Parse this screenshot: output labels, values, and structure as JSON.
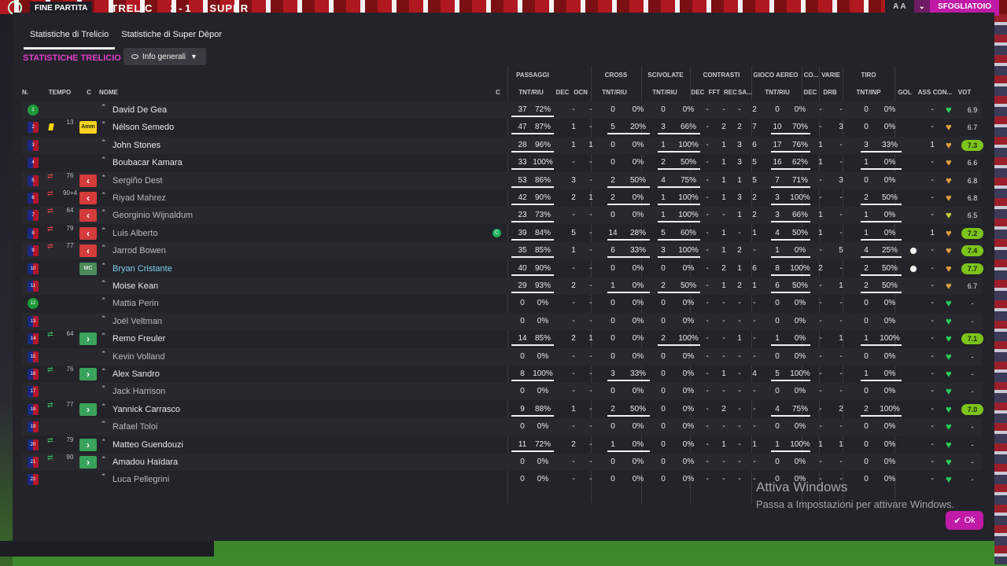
{
  "topbar": {
    "fine_partita": "FINE PARTITA",
    "home": "TRELIC",
    "score": "2 - 1",
    "away": "SUPER",
    "zoom": "A A",
    "sfogliatoio": "SFOGLIATOIO"
  },
  "tabs": [
    {
      "label": "Statistiche di Trelicio",
      "active": true
    },
    {
      "label": "Statistiche di Super Dèpor",
      "active": false
    }
  ],
  "section_title": "STATISTICHE TRELICIO",
  "view_dropdown": {
    "selected": "Info generali"
  },
  "column_groups": [
    "PASSAGGI",
    "CROSS",
    "SCIVOLATE",
    "CONTRASTI",
    "GIOCO AEREO",
    "CO...",
    "VARIE",
    "TIRO"
  ],
  "columns": {
    "n": "N.",
    "tempo": "TEMPO",
    "c": "C",
    "nome": "NOME",
    "c2": "C",
    "pass_tnt": "TNT/RIU",
    "pass_dec": "DEC",
    "pass_ocn": "OCN",
    "cross_tnt": "TNT/RIU",
    "scivol_tnt": "TNT/RIU",
    "con_dec": "DEC",
    "con_fft": "FFT",
    "con_rec": "REC",
    "con_sa": "SA...",
    "aereo_tnt": "TNT/RIU",
    "co_dec": "DEC",
    "varie_drb": "DRB",
    "tiro_tnt": "TNT/INP",
    "gol": "GOL",
    "ass": "ASS",
    "con": "CON...",
    "vot": "VOT"
  },
  "players": [
    {
      "n": "1",
      "gk": true,
      "card": "",
      "sub_dir": "",
      "sub_min": "",
      "role": "",
      "name": "David De Gea",
      "style": "",
      "c": "",
      "pass_t": "37",
      "pass_p": "72%",
      "pass_dec": "-",
      "pass_ocn": "-",
      "cross_t": "0",
      "cross_p": "0%",
      "sci_t": "0",
      "sci_p": "0%",
      "con_dec": "-",
      "con_fft": "-",
      "con_rec": "-",
      "con_sa": "2",
      "aer_t": "0",
      "aer_p": "0%",
      "co_dec": "-",
      "drb": "-",
      "tiro_t": "0",
      "tiro_p": "0%",
      "gol": "",
      "ass": "-",
      "heart": "g",
      "vot": "6.9",
      "vot_hi": false
    },
    {
      "n": "2",
      "gk": false,
      "card": "y",
      "sub_dir": "",
      "sub_min": "13",
      "role": "Amm",
      "name": "Nélson Semedo",
      "style": "",
      "c": "",
      "pass_t": "47",
      "pass_p": "87%",
      "pass_dec": "1",
      "pass_ocn": "-",
      "cross_t": "5",
      "cross_p": "20%",
      "sci_t": "3",
      "sci_p": "66%",
      "con_dec": "-",
      "con_fft": "2",
      "con_rec": "2",
      "con_sa": "7",
      "aer_t": "10",
      "aer_p": "70%",
      "co_dec": "-",
      "drb": "3",
      "tiro_t": "0",
      "tiro_p": "0%",
      "gol": "",
      "ass": "-",
      "heart": "o",
      "vot": "6.7",
      "vot_hi": false
    },
    {
      "n": "3",
      "gk": false,
      "card": "",
      "sub_dir": "",
      "sub_min": "",
      "role": "",
      "name": "John Stones",
      "style": "",
      "c": "",
      "pass_t": "28",
      "pass_p": "96%",
      "pass_dec": "1",
      "pass_ocn": "1",
      "cross_t": "0",
      "cross_p": "0%",
      "sci_t": "1",
      "sci_p": "100%",
      "con_dec": "-",
      "con_fft": "1",
      "con_rec": "3",
      "con_sa": "6",
      "aer_t": "17",
      "aer_p": "76%",
      "co_dec": "1",
      "drb": "-",
      "tiro_t": "3",
      "tiro_p": "33%",
      "gol": "",
      "ass": "1",
      "heart": "o",
      "vot": "7.3",
      "vot_hi": true
    },
    {
      "n": "4",
      "gk": false,
      "card": "",
      "sub_dir": "",
      "sub_min": "",
      "role": "",
      "name": "Boubacar Kamara",
      "style": "",
      "c": "",
      "pass_t": "33",
      "pass_p": "100%",
      "pass_dec": "-",
      "pass_ocn": "-",
      "cross_t": "0",
      "cross_p": "0%",
      "sci_t": "2",
      "sci_p": "50%",
      "con_dec": "-",
      "con_fft": "1",
      "con_rec": "3",
      "con_sa": "5",
      "aer_t": "16",
      "aer_p": "62%",
      "co_dec": "1",
      "drb": "-",
      "tiro_t": "1",
      "tiro_p": "0%",
      "gol": "",
      "ass": "-",
      "heart": "o",
      "vot": "6.6",
      "vot_hi": false
    },
    {
      "n": "5",
      "gk": false,
      "card": "",
      "sub_dir": "out",
      "sub_min": "76",
      "role": "out",
      "name": "Sergiño Dest",
      "style": "dim",
      "c": "",
      "pass_t": "53",
      "pass_p": "86%",
      "pass_dec": "3",
      "pass_ocn": "-",
      "cross_t": "2",
      "cross_p": "50%",
      "sci_t": "4",
      "sci_p": "75%",
      "con_dec": "-",
      "con_fft": "1",
      "con_rec": "1",
      "con_sa": "5",
      "aer_t": "7",
      "aer_p": "71%",
      "co_dec": "-",
      "drb": "3",
      "tiro_t": "0",
      "tiro_p": "0%",
      "gol": "",
      "ass": "-",
      "heart": "o",
      "vot": "6.8",
      "vot_hi": false
    },
    {
      "n": "6",
      "gk": false,
      "card": "",
      "sub_dir": "out",
      "sub_min": "90+4",
      "role": "out",
      "name": "Riyad Mahrez",
      "style": "dim",
      "c": "",
      "pass_t": "42",
      "pass_p": "90%",
      "pass_dec": "2",
      "pass_ocn": "1",
      "cross_t": "2",
      "cross_p": "0%",
      "sci_t": "1",
      "sci_p": "100%",
      "con_dec": "-",
      "con_fft": "1",
      "con_rec": "3",
      "con_sa": "2",
      "aer_t": "3",
      "aer_p": "100%",
      "co_dec": "-",
      "drb": "-",
      "tiro_t": "2",
      "tiro_p": "50%",
      "gol": "",
      "ass": "-",
      "heart": "o",
      "vot": "6.8",
      "vot_hi": false
    },
    {
      "n": "7",
      "gk": false,
      "card": "",
      "sub_dir": "out",
      "sub_min": "64",
      "role": "out",
      "name": "Georginio Wijnaldum",
      "style": "dim",
      "c": "",
      "pass_t": "23",
      "pass_p": "73%",
      "pass_dec": "-",
      "pass_ocn": "-",
      "cross_t": "0",
      "cross_p": "0%",
      "sci_t": "1",
      "sci_p": "100%",
      "con_dec": "-",
      "con_fft": "-",
      "con_rec": "1",
      "con_sa": "2",
      "aer_t": "3",
      "aer_p": "66%",
      "co_dec": "1",
      "drb": "-",
      "tiro_t": "1",
      "tiro_p": "0%",
      "gol": "",
      "ass": "-",
      "heart": "y",
      "vot": "6.5",
      "vot_hi": false
    },
    {
      "n": "8",
      "gk": false,
      "card": "",
      "sub_dir": "out",
      "sub_min": "79",
      "role": "out",
      "name": "Luis Alberto",
      "style": "dim",
      "c": "c",
      "pass_t": "39",
      "pass_p": "84%",
      "pass_dec": "5",
      "pass_ocn": "-",
      "cross_t": "14",
      "cross_p": "28%",
      "sci_t": "5",
      "sci_p": "60%",
      "con_dec": "-",
      "con_fft": "1",
      "con_rec": "-",
      "con_sa": "1",
      "aer_t": "4",
      "aer_p": "50%",
      "co_dec": "1",
      "drb": "-",
      "tiro_t": "1",
      "tiro_p": "0%",
      "gol": "",
      "ass": "1",
      "heart": "o",
      "vot": "7.2",
      "vot_hi": true
    },
    {
      "n": "9",
      "gk": false,
      "card": "",
      "sub_dir": "out",
      "sub_min": "77",
      "role": "out",
      "name": "Jarrod Bowen",
      "style": "dim",
      "c": "",
      "pass_t": "35",
      "pass_p": "85%",
      "pass_dec": "1",
      "pass_ocn": "-",
      "cross_t": "6",
      "cross_p": "33%",
      "sci_t": "3",
      "sci_p": "100%",
      "con_dec": "-",
      "con_fft": "1",
      "con_rec": "2",
      "con_sa": "-",
      "aer_t": "1",
      "aer_p": "0%",
      "co_dec": "-",
      "drb": "5",
      "tiro_t": "4",
      "tiro_p": "25%",
      "gol": "ball",
      "ass": "-",
      "heart": "o",
      "vot": "7.4",
      "vot_hi": true
    },
    {
      "n": "10",
      "gk": false,
      "card": "",
      "sub_dir": "",
      "sub_min": "",
      "role": "MC",
      "name": "Bryan Cristante",
      "style": "hl",
      "c": "",
      "pass_t": "40",
      "pass_p": "90%",
      "pass_dec": "-",
      "pass_ocn": "-",
      "cross_t": "0",
      "cross_p": "0%",
      "sci_t": "0",
      "sci_p": "0%",
      "con_dec": "-",
      "con_fft": "2",
      "con_rec": "1",
      "con_sa": "6",
      "aer_t": "8",
      "aer_p": "100%",
      "co_dec": "2",
      "drb": "-",
      "tiro_t": "2",
      "tiro_p": "50%",
      "gol": "ball",
      "ass": "-",
      "heart": "o",
      "vot": "7.7",
      "vot_hi": true
    },
    {
      "n": "11",
      "gk": false,
      "card": "",
      "sub_dir": "",
      "sub_min": "",
      "role": "",
      "name": "Moise Kean",
      "style": "",
      "c": "",
      "pass_t": "29",
      "pass_p": "93%",
      "pass_dec": "2",
      "pass_ocn": "-",
      "cross_t": "1",
      "cross_p": "0%",
      "sci_t": "2",
      "sci_p": "50%",
      "con_dec": "-",
      "con_fft": "1",
      "con_rec": "2",
      "con_sa": "1",
      "aer_t": "6",
      "aer_p": "50%",
      "co_dec": "-",
      "drb": "1",
      "tiro_t": "2",
      "tiro_p": "50%",
      "gol": "",
      "ass": "-",
      "heart": "o",
      "vot": "6.7",
      "vot_hi": false
    },
    {
      "n": "12",
      "gk": true,
      "card": "",
      "sub_dir": "",
      "sub_min": "",
      "role": "",
      "name": "Mattia Perin",
      "style": "dim",
      "c": "",
      "pass_t": "0",
      "pass_p": "0%",
      "pass_dec": "-",
      "pass_ocn": "-",
      "cross_t": "0",
      "cross_p": "0%",
      "sci_t": "0",
      "sci_p": "0%",
      "con_dec": "-",
      "con_fft": "-",
      "con_rec": "-",
      "con_sa": "-",
      "aer_t": "0",
      "aer_p": "0%",
      "co_dec": "-",
      "drb": "-",
      "tiro_t": "0",
      "tiro_p": "0%",
      "gol": "",
      "ass": "-",
      "heart": "g",
      "vot": "-",
      "vot_hi": false
    },
    {
      "n": "13",
      "gk": false,
      "card": "",
      "sub_dir": "",
      "sub_min": "",
      "role": "",
      "name": "Joël Veltman",
      "style": "dim",
      "c": "",
      "pass_t": "0",
      "pass_p": "0%",
      "pass_dec": "-",
      "pass_ocn": "-",
      "cross_t": "0",
      "cross_p": "0%",
      "sci_t": "0",
      "sci_p": "0%",
      "con_dec": "-",
      "con_fft": "-",
      "con_rec": "-",
      "con_sa": "-",
      "aer_t": "0",
      "aer_p": "0%",
      "co_dec": "-",
      "drb": "-",
      "tiro_t": "0",
      "tiro_p": "0%",
      "gol": "",
      "ass": "-",
      "heart": "g",
      "vot": "-",
      "vot_hi": false
    },
    {
      "n": "14",
      "gk": false,
      "card": "",
      "sub_dir": "in",
      "sub_min": "64",
      "role": "in",
      "name": "Remo Freuler",
      "style": "",
      "c": "",
      "pass_t": "14",
      "pass_p": "85%",
      "pass_dec": "2",
      "pass_ocn": "1",
      "cross_t": "0",
      "cross_p": "0%",
      "sci_t": "2",
      "sci_p": "100%",
      "con_dec": "-",
      "con_fft": "-",
      "con_rec": "1",
      "con_sa": "-",
      "aer_t": "1",
      "aer_p": "0%",
      "co_dec": "-",
      "drb": "1",
      "tiro_t": "1",
      "tiro_p": "100%",
      "gol": "",
      "ass": "-",
      "heart": "g",
      "vot": "7.1",
      "vot_hi": true
    },
    {
      "n": "15",
      "gk": false,
      "card": "",
      "sub_dir": "",
      "sub_min": "",
      "role": "",
      "name": "Kevin Volland",
      "style": "dim",
      "c": "",
      "pass_t": "0",
      "pass_p": "0%",
      "pass_dec": "-",
      "pass_ocn": "-",
      "cross_t": "0",
      "cross_p": "0%",
      "sci_t": "0",
      "sci_p": "0%",
      "con_dec": "-",
      "con_fft": "-",
      "con_rec": "-",
      "con_sa": "-",
      "aer_t": "0",
      "aer_p": "0%",
      "co_dec": "-",
      "drb": "-",
      "tiro_t": "0",
      "tiro_p": "0%",
      "gol": "",
      "ass": "-",
      "heart": "g",
      "vot": "-",
      "vot_hi": false
    },
    {
      "n": "16",
      "gk": false,
      "card": "",
      "sub_dir": "in",
      "sub_min": "76",
      "role": "in",
      "name": "Alex Sandro",
      "style": "",
      "c": "",
      "pass_t": "8",
      "pass_p": "100%",
      "pass_dec": "-",
      "pass_ocn": "-",
      "cross_t": "3",
      "cross_p": "33%",
      "sci_t": "0",
      "sci_p": "0%",
      "con_dec": "-",
      "con_fft": "1",
      "con_rec": "-",
      "con_sa": "4",
      "aer_t": "5",
      "aer_p": "100%",
      "co_dec": "-",
      "drb": "-",
      "tiro_t": "1",
      "tiro_p": "0%",
      "gol": "",
      "ass": "-",
      "heart": "g",
      "vot": "-",
      "vot_hi": false
    },
    {
      "n": "17",
      "gk": false,
      "card": "",
      "sub_dir": "",
      "sub_min": "",
      "role": "",
      "name": "Jack Harrison",
      "style": "dim",
      "c": "",
      "pass_t": "0",
      "pass_p": "0%",
      "pass_dec": "-",
      "pass_ocn": "-",
      "cross_t": "0",
      "cross_p": "0%",
      "sci_t": "0",
      "sci_p": "0%",
      "con_dec": "-",
      "con_fft": "-",
      "con_rec": "-",
      "con_sa": "-",
      "aer_t": "0",
      "aer_p": "0%",
      "co_dec": "-",
      "drb": "-",
      "tiro_t": "0",
      "tiro_p": "0%",
      "gol": "",
      "ass": "-",
      "heart": "g",
      "vot": "-",
      "vot_hi": false
    },
    {
      "n": "18",
      "gk": false,
      "card": "",
      "sub_dir": "in",
      "sub_min": "77",
      "role": "in",
      "name": "Yannick Carrasco",
      "style": "",
      "c": "",
      "pass_t": "9",
      "pass_p": "88%",
      "pass_dec": "1",
      "pass_ocn": "-",
      "cross_t": "2",
      "cross_p": "50%",
      "sci_t": "0",
      "sci_p": "0%",
      "con_dec": "-",
      "con_fft": "2",
      "con_rec": "-",
      "con_sa": "-",
      "aer_t": "4",
      "aer_p": "75%",
      "co_dec": "-",
      "drb": "2",
      "tiro_t": "2",
      "tiro_p": "100%",
      "gol": "",
      "ass": "-",
      "heart": "g",
      "vot": "7.0",
      "vot_hi": true
    },
    {
      "n": "19",
      "gk": false,
      "card": "",
      "sub_dir": "",
      "sub_min": "",
      "role": "",
      "name": "Rafael Toloi",
      "style": "dim",
      "c": "",
      "pass_t": "0",
      "pass_p": "0%",
      "pass_dec": "-",
      "pass_ocn": "-",
      "cross_t": "0",
      "cross_p": "0%",
      "sci_t": "0",
      "sci_p": "0%",
      "con_dec": "-",
      "con_fft": "-",
      "con_rec": "-",
      "con_sa": "-",
      "aer_t": "0",
      "aer_p": "0%",
      "co_dec": "-",
      "drb": "-",
      "tiro_t": "0",
      "tiro_p": "0%",
      "gol": "",
      "ass": "-",
      "heart": "g",
      "vot": "-",
      "vot_hi": false
    },
    {
      "n": "20",
      "gk": false,
      "card": "",
      "sub_dir": "in",
      "sub_min": "79",
      "role": "in",
      "name": "Matteo Guendouzi",
      "style": "",
      "c": "",
      "pass_t": "11",
      "pass_p": "72%",
      "pass_dec": "2",
      "pass_ocn": "-",
      "cross_t": "1",
      "cross_p": "0%",
      "sci_t": "0",
      "sci_p": "0%",
      "con_dec": "-",
      "con_fft": "1",
      "con_rec": "-",
      "con_sa": "1",
      "aer_t": "1",
      "aer_p": "100%",
      "co_dec": "1",
      "drb": "1",
      "tiro_t": "0",
      "tiro_p": "0%",
      "gol": "",
      "ass": "-",
      "heart": "g",
      "vot": "-",
      "vot_hi": false
    },
    {
      "n": "21",
      "gk": false,
      "card": "",
      "sub_dir": "in",
      "sub_min": "90",
      "role": "in",
      "name": "Amadou Haïdara",
      "style": "",
      "c": "",
      "pass_t": "0",
      "pass_p": "0%",
      "pass_dec": "-",
      "pass_ocn": "-",
      "cross_t": "0",
      "cross_p": "0%",
      "sci_t": "0",
      "sci_p": "0%",
      "con_dec": "-",
      "con_fft": "-",
      "con_rec": "-",
      "con_sa": "-",
      "aer_t": "0",
      "aer_p": "0%",
      "co_dec": "-",
      "drb": "-",
      "tiro_t": "0",
      "tiro_p": "0%",
      "gol": "",
      "ass": "-",
      "heart": "g",
      "vot": "-",
      "vot_hi": false
    },
    {
      "n": "22",
      "gk": false,
      "card": "",
      "sub_dir": "",
      "sub_min": "",
      "role": "",
      "name": "Luca Pellegrini",
      "style": "dim",
      "c": "",
      "pass_t": "0",
      "pass_p": "0%",
      "pass_dec": "-",
      "pass_ocn": "-",
      "cross_t": "0",
      "cross_p": "0%",
      "sci_t": "0",
      "sci_p": "0%",
      "con_dec": "-",
      "con_fft": "-",
      "con_rec": "-",
      "con_sa": "-",
      "aer_t": "0",
      "aer_p": "0%",
      "co_dec": "-",
      "drb": "-",
      "tiro_t": "0",
      "tiro_p": "0%",
      "gol": "",
      "ass": "-",
      "heart": "g",
      "vot": "-",
      "vot_hi": false
    }
  ],
  "watermark": {
    "line1": "Attiva Windows",
    "line2": "Passa a Impostazioni per attivare Windows."
  },
  "ok_button": "Ok",
  "colors": {
    "accent": "#c01aa6",
    "title": "#e03ec8",
    "vote_high": "#7cc31a"
  }
}
